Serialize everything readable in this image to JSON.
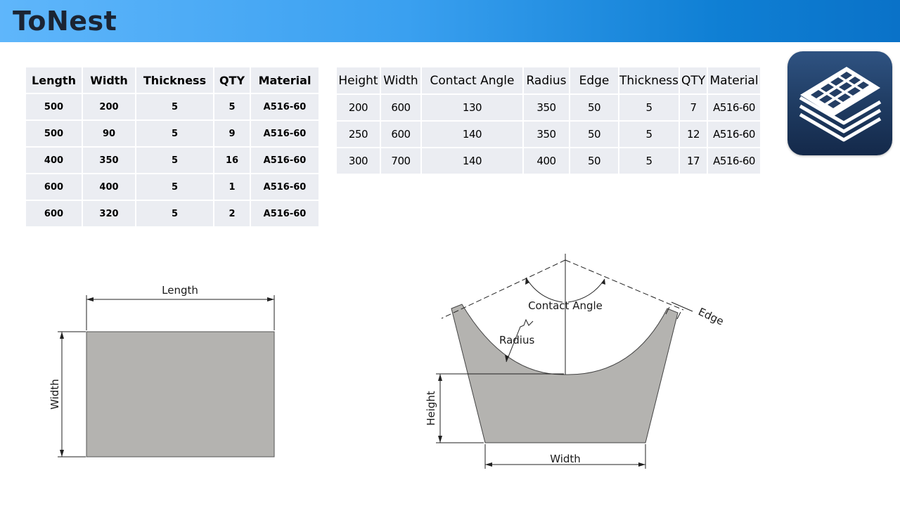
{
  "header": {
    "brand": "ToNest"
  },
  "table_left": {
    "headers": [
      "Length",
      "Width",
      "Thickness",
      "QTY",
      "Material"
    ],
    "rows": [
      [
        "500",
        "200",
        "5",
        "5",
        "A516-60"
      ],
      [
        "500",
        "90",
        "5",
        "9",
        "A516-60"
      ],
      [
        "400",
        "350",
        "5",
        "16",
        "A516-60"
      ],
      [
        "600",
        "400",
        "5",
        "1",
        "A516-60"
      ],
      [
        "600",
        "320",
        "5",
        "2",
        "A516-60"
      ]
    ]
  },
  "table_right": {
    "headers": [
      "Height",
      "Width",
      "Contact Angle",
      "Radius",
      "Edge",
      "Thickness",
      "QTY",
      "Material"
    ],
    "rows": [
      [
        "200",
        "600",
        "130",
        "350",
        "50",
        "5",
        "7",
        "A516-60"
      ],
      [
        "250",
        "600",
        "140",
        "350",
        "50",
        "5",
        "12",
        "A516-60"
      ],
      [
        "300",
        "700",
        "140",
        "400",
        "50",
        "5",
        "17",
        "A516-60"
      ]
    ]
  },
  "rect_drawing": {
    "length_label": "Length",
    "width_label": "Width"
  },
  "saddle_drawing": {
    "contact_angle_label": "Contact Angle",
    "radius_label": "Radius",
    "edge_label": "Edge",
    "height_label": "Height",
    "width_label": "Width"
  },
  "colors": {
    "part_fill": "#b4b3b0",
    "table_cell": "#ebedf2",
    "header_start": "#5fb6fb",
    "header_end": "#0a72c8"
  },
  "icons": {
    "app_icon": "nesting-sheets-icon"
  }
}
